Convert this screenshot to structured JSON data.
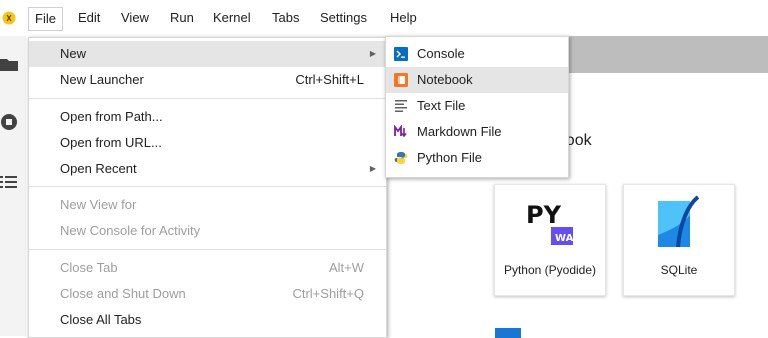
{
  "menubar": {
    "items": [
      {
        "label": "File",
        "active": true
      },
      {
        "label": "Edit"
      },
      {
        "label": "View"
      },
      {
        "label": "Run"
      },
      {
        "label": "Kernel"
      },
      {
        "label": "Tabs"
      },
      {
        "label": "Settings"
      },
      {
        "label": "Help"
      }
    ]
  },
  "file_menu": {
    "new": {
      "label": "New"
    },
    "new_launcher": {
      "label": "New Launcher",
      "shortcut": "Ctrl+Shift+L"
    },
    "open_from_path": {
      "label": "Open from Path..."
    },
    "open_from_url": {
      "label": "Open from URL..."
    },
    "open_recent": {
      "label": "Open Recent"
    },
    "new_view_for": {
      "label": "New View for"
    },
    "new_console_for_activity": {
      "label": "New Console for Activity"
    },
    "close_tab": {
      "label": "Close Tab",
      "shortcut": "Alt+W"
    },
    "close_and_shut_down": {
      "label": "Close and Shut Down",
      "shortcut": "Ctrl+Shift+Q"
    },
    "close_all_tabs": {
      "label": "Close All Tabs"
    }
  },
  "new_submenu": {
    "items": [
      {
        "label": "Console",
        "icon": "console-icon"
      },
      {
        "label": "Notebook",
        "icon": "notebook-icon"
      },
      {
        "label": "Text File",
        "icon": "text-file-icon"
      },
      {
        "label": "Markdown File",
        "icon": "markdown-icon"
      },
      {
        "label": "Python File",
        "icon": "python-icon"
      }
    ]
  },
  "launcher": {
    "heading_visible_fragment": "ebook",
    "cards": [
      {
        "label": "Python (Pyodide)",
        "icon": "pyodide-logo"
      },
      {
        "label": "SQLite",
        "icon": "sqlite-logo"
      }
    ],
    "pyodide_badge": "WA",
    "pyodide_text": "PY"
  },
  "colors": {
    "highlight": "#e5e5e5",
    "disabled_text": "#9e9e9e",
    "tabstrip": "#bdbdbd",
    "brand_orange": "#f37726",
    "console_blue": "#0a6ebd",
    "markdown_purple": "#7b1fa2"
  }
}
